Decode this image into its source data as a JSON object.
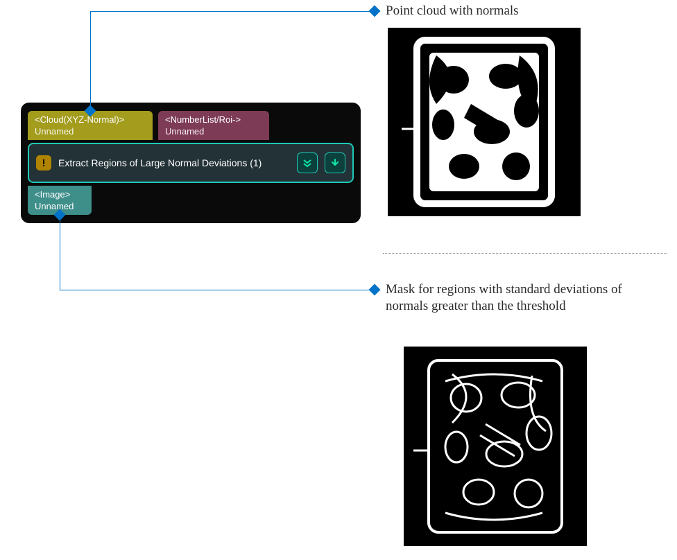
{
  "node": {
    "ports": {
      "cloud": {
        "type": "<Cloud(XYZ-Normal)>",
        "name": "Unnamed"
      },
      "list": {
        "type": "<NumberList/Roi->",
        "name": "Unnamed"
      }
    },
    "step": {
      "label": "Extract Regions of Large Normal Deviations (1)"
    },
    "outport": {
      "type": "<Image>",
      "name": "Unnamed"
    }
  },
  "annotations": {
    "top": "Point cloud with normals",
    "bottom": "Mask for regions with standard deviations of normals greater than the threshold"
  }
}
